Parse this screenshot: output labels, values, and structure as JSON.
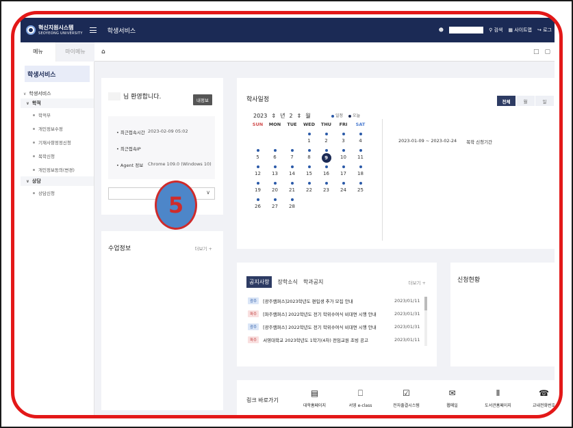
{
  "topbar": {
    "logo_main": "혁신지원시스템",
    "logo_sub": "SEOYEONG UNIVERSITY",
    "title": "학생서비스",
    "search_label": "검색",
    "sitemap_label": "사이트맵",
    "logout_label": "로그"
  },
  "subbar": {
    "tab_menu": "메뉴",
    "tab_mymenu": "마이메뉴"
  },
  "sidebar": {
    "header": "학생서비스",
    "root": "학생서비스",
    "group_academic": "학적",
    "academic_items": [
      "학적부",
      "개인정보수정",
      "기재사항정정신청",
      "복학신청",
      "개인정보동의(변경)"
    ],
    "group_counsel": "상담",
    "counsel_items": [
      "상담신청"
    ]
  },
  "welcome": {
    "greeting": "님 환영합니다.",
    "info_button": "내정보",
    "last_login_label": "최근접속시간",
    "last_login_value": "2023-02-09 05:02",
    "last_ip_label": "최근접속IP",
    "agent_label": "Agent 정보",
    "agent_value": "Chrome 109.0 (Windows 10)"
  },
  "class_info": {
    "title": "수업정보",
    "more": "더보기 +"
  },
  "calendar": {
    "title": "학사일정",
    "view_tabs": [
      "전체",
      "월",
      "일"
    ],
    "year": "2023",
    "year_unit": "년",
    "month": "2",
    "month_unit": "월",
    "legend_schedule": "일정",
    "legend_today": "오늘",
    "weekdays": [
      "SUN",
      "MON",
      "TUE",
      "WED",
      "THU",
      "FRI",
      "SAT"
    ],
    "weeks": [
      [
        "",
        "",
        "",
        "1",
        "2",
        "3",
        "4"
      ],
      [
        "5",
        "6",
        "7",
        "8",
        "9",
        "10",
        "11"
      ],
      [
        "12",
        "13",
        "14",
        "15",
        "16",
        "17",
        "18"
      ],
      [
        "19",
        "20",
        "21",
        "22",
        "23",
        "24",
        "25"
      ],
      [
        "26",
        "27",
        "28",
        "",
        "",
        "",
        ""
      ]
    ],
    "today": "9",
    "period_range": "2023-01-09 ~ 2023-02-24",
    "period_label": "복학 신청기간",
    "overlay_badge": "5"
  },
  "notice": {
    "tabs": [
      "공지사항",
      "장학소식",
      "학과공지"
    ],
    "more": "더보기 +",
    "items": [
      {
        "tag": "광주",
        "text": "[광주캠퍼스]2023학년도 편입생 추가 모집 안내",
        "date": "2023/01/11"
      },
      {
        "tag": "파주",
        "text": "[파주캠퍼스] 2022학년도 전기 학위수여식 비대면 시행 안내",
        "date": "2023/01/31"
      },
      {
        "tag": "광주",
        "text": "[광주캠퍼스] 2022학년도 전기 학위수여식 비대면 시행 안내",
        "date": "2023/01/31"
      },
      {
        "tag": "파주",
        "text": "서영대학교 2023학년도 1학기(4차) 전임교원 초빙 공고",
        "date": "2023/01/11"
      }
    ]
  },
  "apply": {
    "title": "신청현황"
  },
  "links": {
    "title": "링크 바로가기",
    "items": [
      "대학홈페이지",
      "서영 e-class",
      "전자출결시스템",
      "웹메일",
      "도서관홈페이지",
      "교내전화번호"
    ]
  },
  "colors": {
    "navy": "#1b2a55",
    "accent_red": "#e31818",
    "schedule_dot": "#2b5aa8",
    "badge_blue": "#4d86c9"
  }
}
